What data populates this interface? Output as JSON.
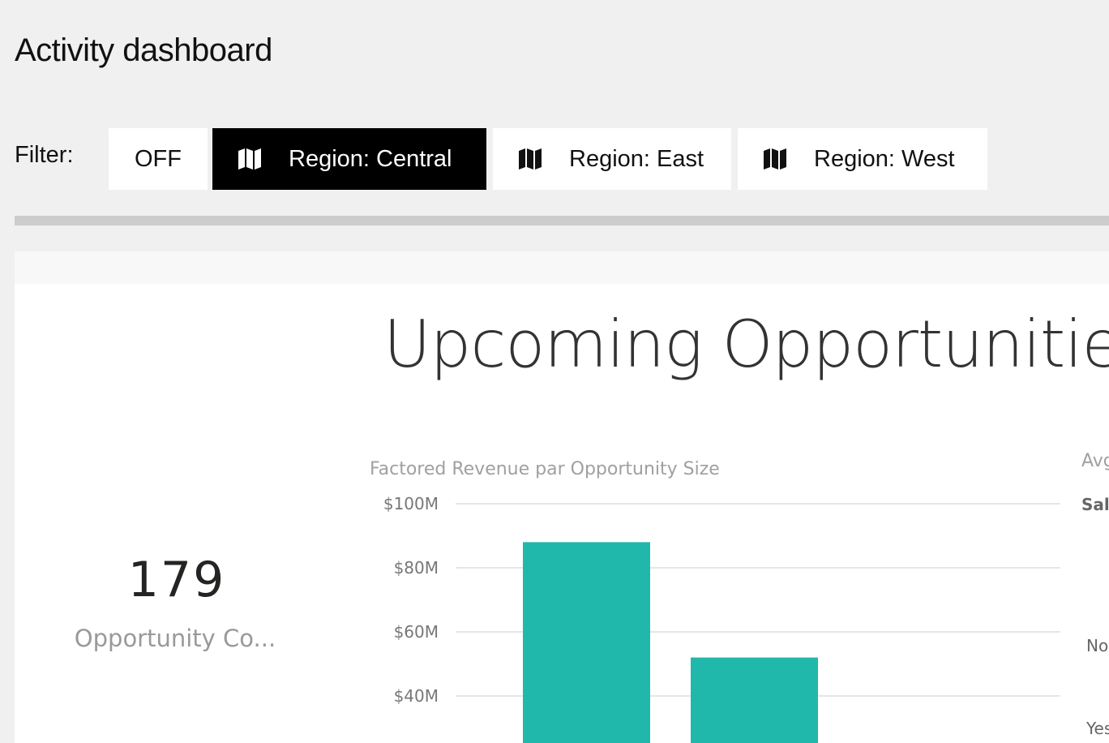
{
  "header": {
    "title": "Activity dashboard"
  },
  "filter": {
    "label": "Filter:",
    "buttons": [
      {
        "label": "OFF",
        "icon": "",
        "active": false
      },
      {
        "label": "Region: Central",
        "icon": "map-icon",
        "active": true
      },
      {
        "label": "Region: East",
        "icon": "map-icon",
        "active": false
      },
      {
        "label": "Region: West",
        "icon": "map-icon",
        "active": false
      }
    ]
  },
  "report": {
    "title": "Upcoming Opportunities b",
    "kpi": {
      "value": "179",
      "label": "Opportunity Co..."
    },
    "right_visual": {
      "title": "Avg",
      "legend": "Sale",
      "categories": [
        "No",
        "Yes"
      ]
    }
  },
  "colors": {
    "bar": "#20b8aa",
    "active_filter_bg": "#000000",
    "gridline": "#e6e6e6"
  },
  "chart_data": {
    "type": "bar",
    "title": "Factored Revenue par Opportunity Size",
    "xlabel": "",
    "ylabel": "",
    "y_ticks": [
      "$40M",
      "$60M",
      "$80M",
      "$100M"
    ],
    "y_tick_values": [
      40,
      60,
      80,
      100
    ],
    "ylim": [
      30,
      100
    ],
    "categories": [
      "",
      ""
    ],
    "values": [
      88,
      52
    ],
    "grid": true
  }
}
